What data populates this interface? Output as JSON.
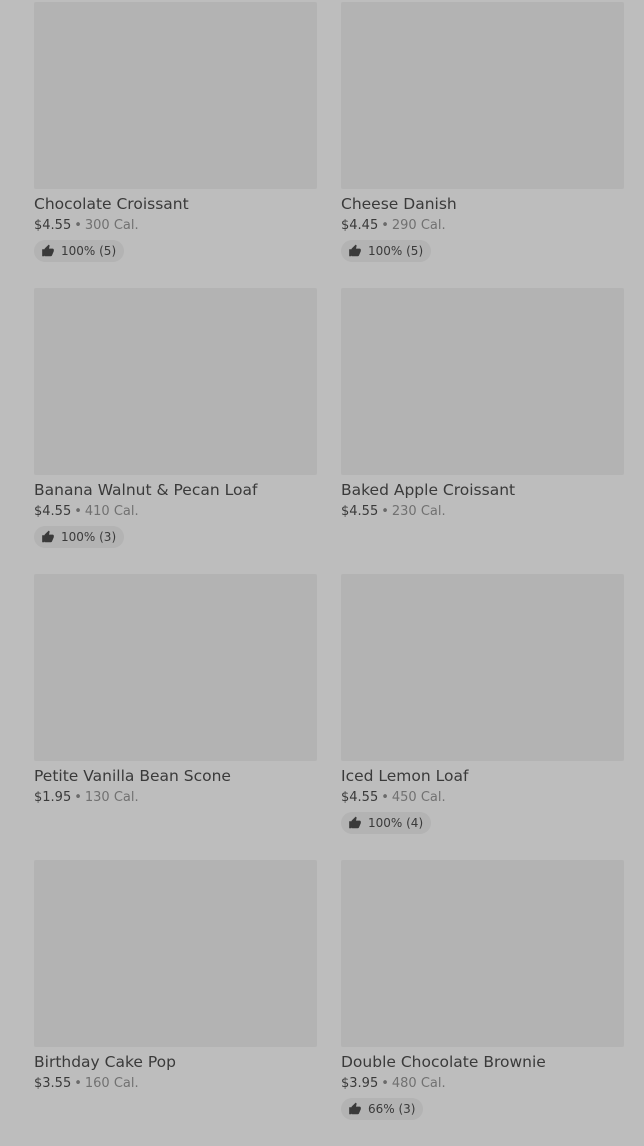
{
  "products": [
    {
      "name": "Chocolate Croissant",
      "price": "$4.55",
      "calories": "300 Cal.",
      "rating": "100% (5)"
    },
    {
      "name": "Cheese Danish",
      "price": "$4.45",
      "calories": "290 Cal.",
      "rating": "100% (5)"
    },
    {
      "name": "Banana Walnut & Pecan Loaf",
      "price": "$4.55",
      "calories": "410 Cal.",
      "rating": "100% (3)"
    },
    {
      "name": "Baked Apple Croissant",
      "price": "$4.55",
      "calories": "230 Cal.",
      "rating": null
    },
    {
      "name": "Petite Vanilla Bean Scone",
      "price": "$1.95",
      "calories": "130 Cal.",
      "rating": null
    },
    {
      "name": "Iced Lemon Loaf",
      "price": "$4.55",
      "calories": "450 Cal.",
      "rating": "100% (4)"
    },
    {
      "name": "Birthday Cake Pop",
      "price": "$3.55",
      "calories": "160 Cal.",
      "rating": null
    },
    {
      "name": "Double Chocolate Brownie",
      "price": "$3.95",
      "calories": "480 Cal.",
      "rating": "66% (3)"
    }
  ],
  "separator": "•",
  "icons": {
    "rating": "thumbs-up-icon"
  },
  "colors": {
    "background": "#bdbdbd",
    "image_placeholder": "#b3b3b3"
  }
}
